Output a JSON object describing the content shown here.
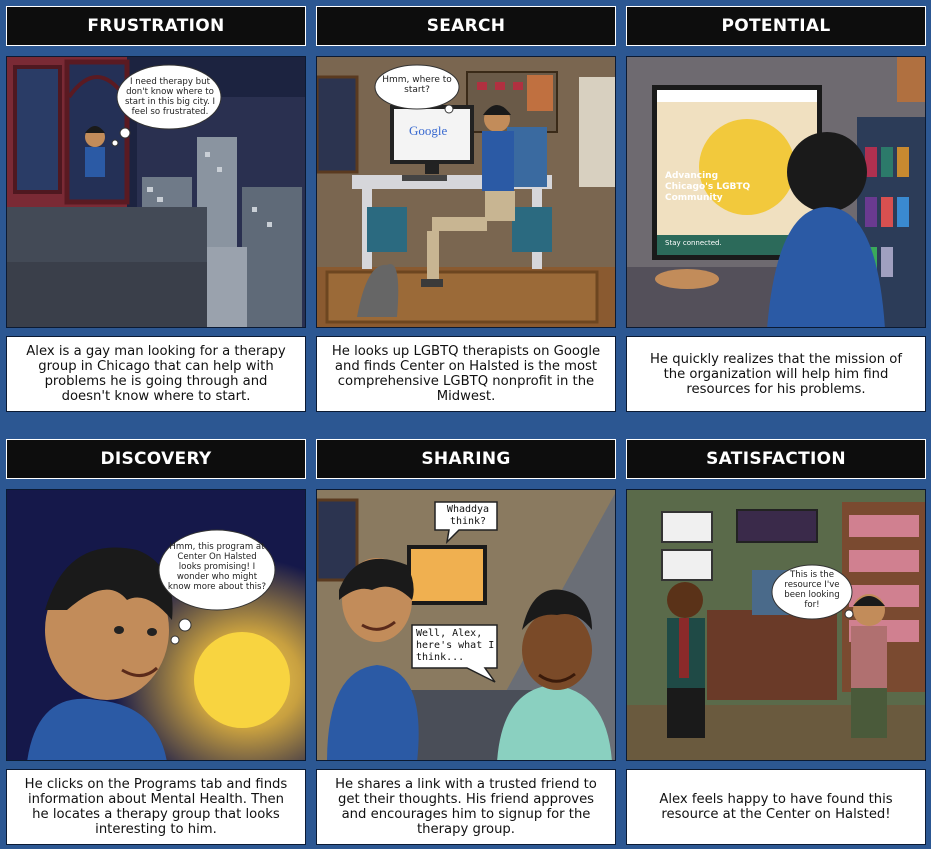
{
  "panels": [
    {
      "title": "FRUSTRATION",
      "bubble": "I need therapy but don't know where to start in this big city. I feel so frustrated.",
      "caption": "Alex is a gay man looking for a therapy group in Chicago that can help with problems he is going through and doesn't know where to start."
    },
    {
      "title": "SEARCH",
      "bubble": "Hmm, where to start?",
      "screen_logo": "Google",
      "caption": "He looks up LGBTQ therapists on Google and finds Center on Halsted is the most comprehensive LGBTQ nonprofit in the Midwest."
    },
    {
      "title": "POTENTIAL",
      "screen_headline": "Advancing Chicago's LGBTQ Community",
      "screen_footer": "Stay connected.",
      "caption": "He quickly realizes that the mission of the organization will help him find resources for his problems."
    },
    {
      "title": "DISCOVERY",
      "bubble": "Hmm, this program at Center On Halsted looks promising! I wonder who might know more about this?",
      "caption": "He clicks on the Programs tab and finds information about Mental Health. Then he locates a therapy group that looks interesting to him."
    },
    {
      "title": "SHARING",
      "bubble_1": "Whaddya think?",
      "bubble_2": "Well, Alex, here's what I think...",
      "caption": "He shares a link with a trusted friend to get their thoughts. His friend approves and encourages him to signup for the therapy group."
    },
    {
      "title": "SATISFACTION",
      "bubble": "This is the resource I've been looking for!",
      "caption": "Alex feels happy to have found this resource at the Center on Halsted!"
    }
  ],
  "colors": {
    "background": "#2c5792",
    "title_bar": "#0d0d0d",
    "caption_bg": "#ffffff"
  }
}
